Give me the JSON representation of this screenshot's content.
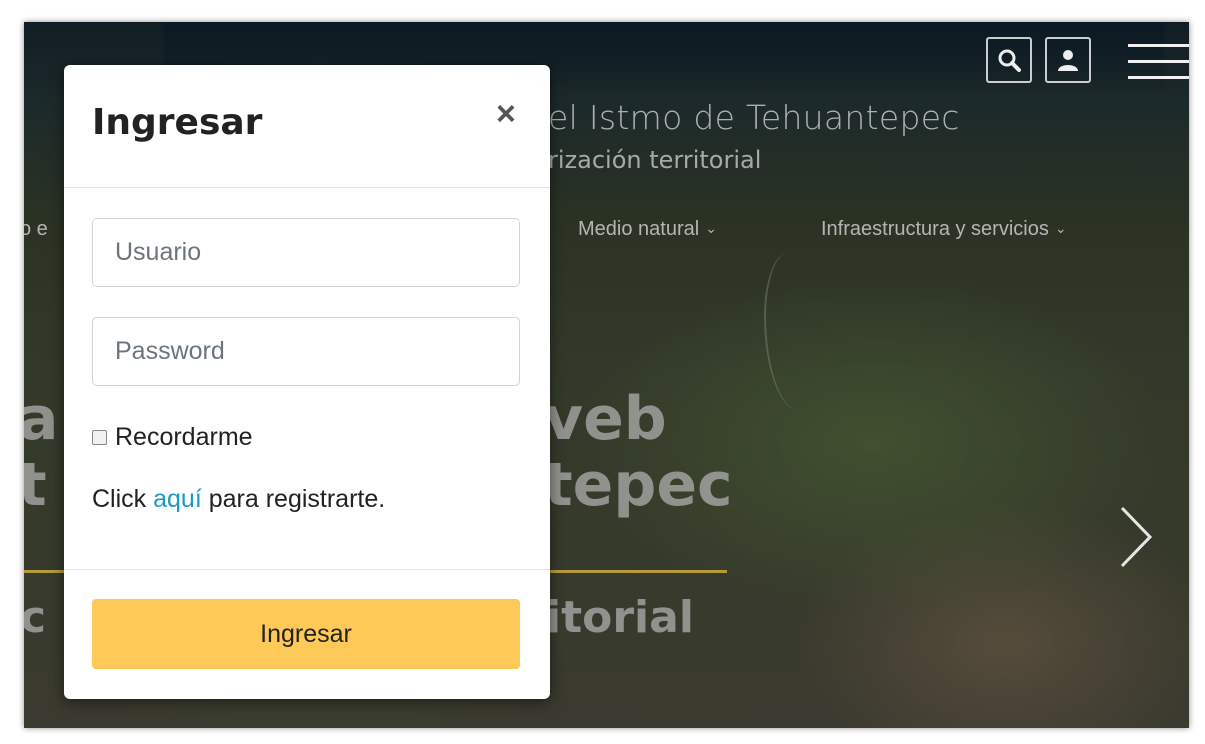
{
  "header": {
    "site_title": "el Istmo de Tehuantepec",
    "site_subtitle": "rización territorial"
  },
  "nav": {
    "left_fragment": "o e",
    "medio_natural": "Medio natural",
    "infraestructura": "Infraestructura y servicios",
    "chevron": "⌄"
  },
  "hero": {
    "line1_left": "a",
    "line1_right": "veb",
    "line2_left": "t",
    "line2_right": "tepec",
    "line3_left": "c",
    "line3_right": "itorial"
  },
  "modal": {
    "title": "Ingresar",
    "close": "×",
    "username_placeholder": "Usuario",
    "password_placeholder": "Password",
    "remember_label": "Recordarme",
    "register_prefix": "Click ",
    "register_link": "aquí",
    "register_suffix": " para registrarte.",
    "submit_label": "Ingresar"
  },
  "icons": {
    "search": "search-icon",
    "user": "user-icon",
    "menu": "hamburger-menu-icon",
    "next": "chevron-right-icon"
  },
  "colors": {
    "accent_button": "#ffc957",
    "link": "#1a9bc2",
    "hero_rule": "#b89a3e"
  }
}
